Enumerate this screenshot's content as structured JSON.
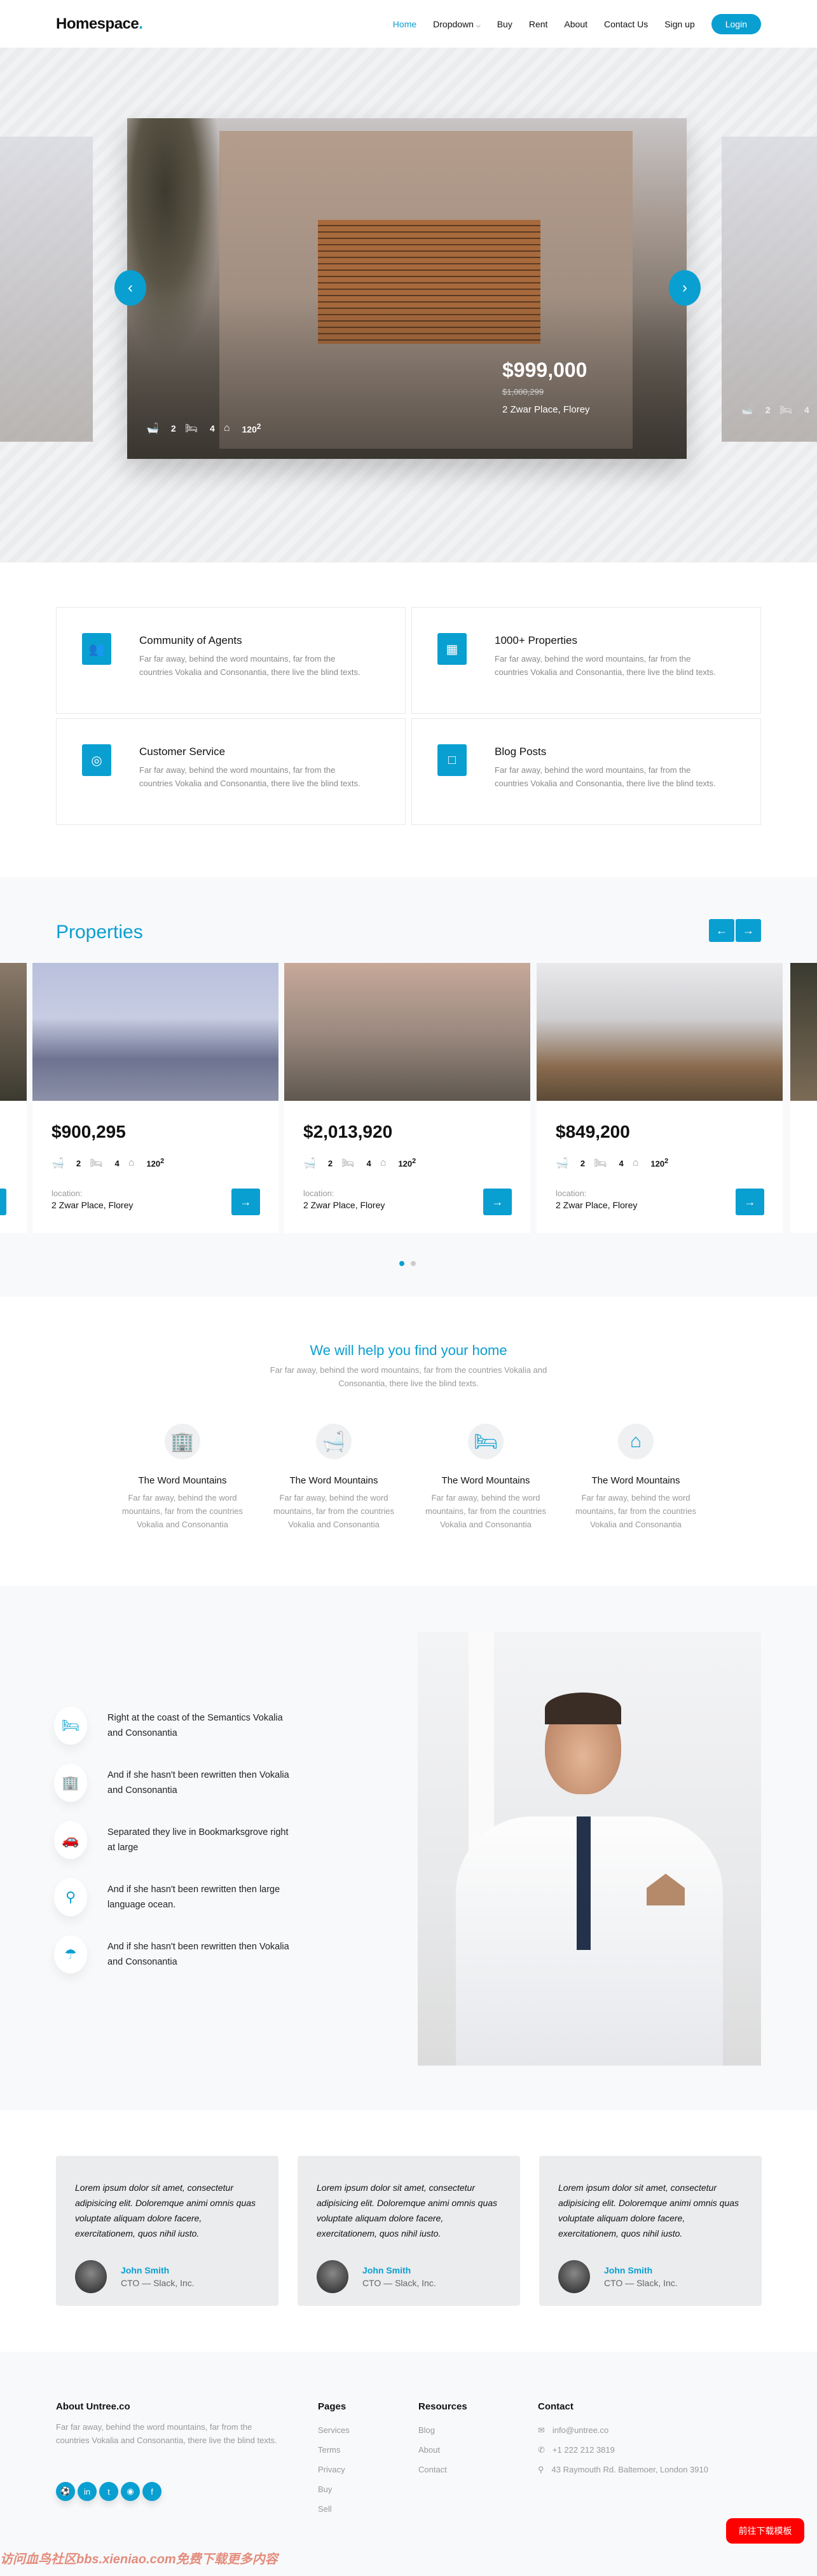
{
  "nav": {
    "logo": "Homespace",
    "logo_dot": ".",
    "items": [
      "Home",
      "Dropdown",
      "Buy",
      "Rent",
      "About",
      "Contact Us",
      "Sign up"
    ],
    "login": "Login",
    "accent": "#0a9fd1"
  },
  "hero": {
    "price": "$999,000",
    "old_price": "$1,000,299",
    "address": "2 Zwar Place, Florey",
    "baths": "2",
    "beds": "4",
    "area": "120",
    "area_sup": "2",
    "side_baths": "2",
    "side_beds": "4"
  },
  "features": [
    {
      "icon": "users-icon",
      "title": "Community of Agents",
      "text": "Far far away, behind the word mountains, far from the countries Vokalia and Consonantia, there live the blind texts."
    },
    {
      "icon": "building-icon",
      "title": "1000+ Properties",
      "text": "Far far away, behind the word mountains, far from the countries Vokalia and Consonantia, there live the blind texts."
    },
    {
      "icon": "lifebuoy-icon",
      "title": "Customer Service",
      "text": "Far far away, behind the word mountains, far from the countries Vokalia and Consonantia, there live the blind texts."
    },
    {
      "icon": "chat-icon",
      "title": "Blog Posts",
      "text": "Far far away, behind the word mountains, far from the countries Vokalia and Consonantia, there live the blind texts."
    }
  ],
  "properties": {
    "title": "Properties",
    "location_label": "location:",
    "cards": [
      {
        "price": "$900,295",
        "baths": "2",
        "beds": "4",
        "area": "120",
        "address": "2 Zwar Place, Florey"
      },
      {
        "price": "$2,013,920",
        "baths": "2",
        "beds": "4",
        "area": "120",
        "address": "2 Zwar Place, Florey"
      },
      {
        "price": "$849,200",
        "baths": "2",
        "beds": "4",
        "area": "120",
        "address": "2 Zwar Place, Florey"
      }
    ],
    "active_dot": 1,
    "dot_count": 2
  },
  "help": {
    "title": "We will help you find your home",
    "subtitle": "Far far away, behind the word mountains, far from the countries Vokalia and Consonantia, there live the blind texts.",
    "columns": [
      {
        "icon": "buildings-icon",
        "title": "The Word Mountains",
        "text": "Far far away, behind the word mountains, far from the countries Vokalia and Consonantia"
      },
      {
        "icon": "bathtub-icon",
        "title": "The Word Mountains",
        "text": "Far far away, behind the word mountains, far from the countries Vokalia and Consonantia"
      },
      {
        "icon": "bed-icon",
        "title": "The Word Mountains",
        "text": "Far far away, behind the word mountains, far from the countries Vokalia and Consonantia"
      },
      {
        "icon": "house-area-icon",
        "title": "The Word Mountains",
        "text": "Far far away, behind the word mountains, far from the countries Vokalia and Consonantia"
      }
    ]
  },
  "why": {
    "items": [
      {
        "icon": "bed-icon",
        "text": "Right at the coast of the Semantics Vokalia and Consonantia"
      },
      {
        "icon": "buildings-icon",
        "text": "And if she hasn't been rewritten then Vokalia and Consonantia"
      },
      {
        "icon": "garage-car-icon",
        "text": "Separated they live in Bookmarksgrove right at large"
      },
      {
        "icon": "map-pin-icon",
        "text": "And if she hasn't been rewritten then large language ocean."
      },
      {
        "icon": "shower-icon",
        "text": "And if she hasn't been rewritten then Vokalia and Consonantia"
      }
    ]
  },
  "testimonials": [
    {
      "quote": "Lorem ipsum dolor sit amet, consectetur adipisicing elit. Doloremque animi omnis quas voluptate aliquam dolore facere, exercitationem, quos nihil iusto.",
      "name": "John Smith",
      "role": "CTO — Slack, Inc."
    },
    {
      "quote": "Lorem ipsum dolor sit amet, consectetur adipisicing elit. Doloremque animi omnis quas voluptate aliquam dolore facere, exercitationem, quos nihil iusto.",
      "name": "John Smith",
      "role": "CTO — Slack, Inc."
    },
    {
      "quote": "Lorem ipsum dolor sit amet, consectetur adipisicing elit. Doloremque animi omnis quas voluptate aliquam dolore facere, exercitationem, quos nihil iusto.",
      "name": "John Smith",
      "role": "CTO — Slack, Inc."
    }
  ],
  "footer": {
    "about_title": "About Untree.co",
    "about_text": "Far far away, behind the word mountains, far from the countries Vokalia and Consonantia, there live the blind texts.",
    "social": [
      "dribbble-icon",
      "linkedin-icon",
      "twitter-icon",
      "instagram-icon",
      "facebook-icon"
    ],
    "pages_title": "Pages",
    "pages": [
      "Services",
      "Terms",
      "Privacy",
      "Buy",
      "Sell"
    ],
    "resources_title": "Resources",
    "resources": [
      "Blog",
      "About",
      "Contact"
    ],
    "contact_title": "Contact",
    "email": "info@untree.co",
    "phone": "+1 222 212 3819",
    "address": "43 Raymouth Rd. Baltemoer, London 3910"
  },
  "download_button": "前往下载模板",
  "watermark": "访问血鸟社区bbs.xieniao.com免费下载更多内容"
}
